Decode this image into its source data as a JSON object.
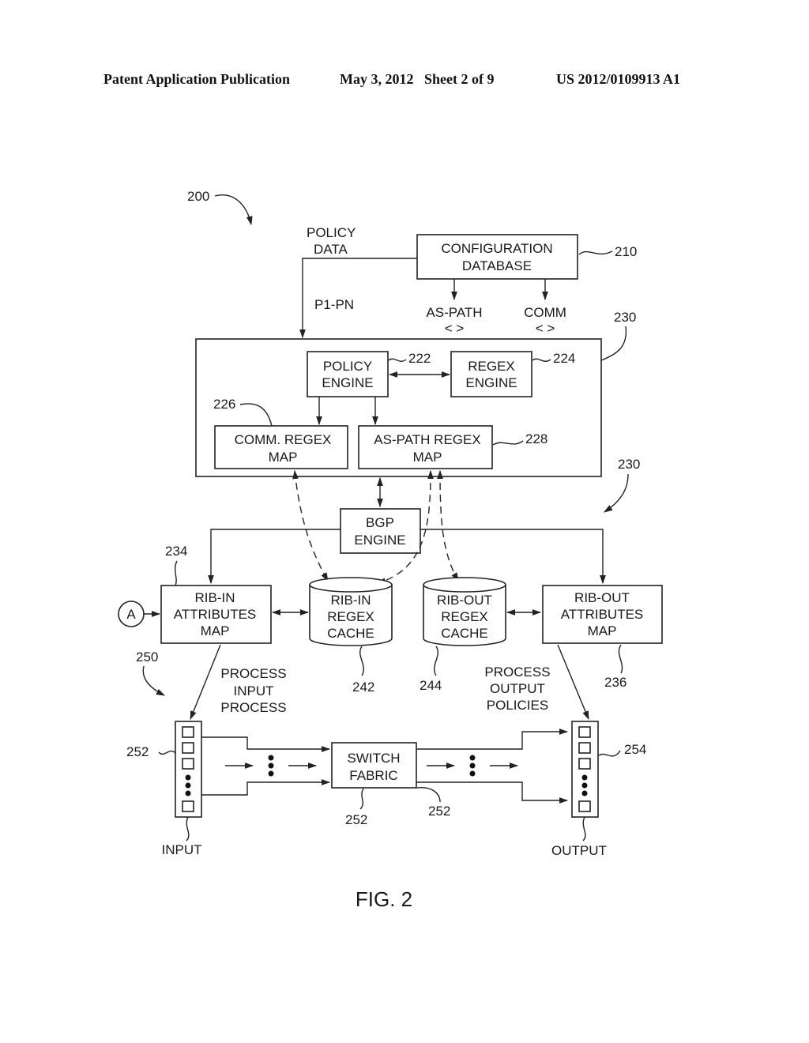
{
  "header": {
    "publication": "Patent Application Publication",
    "date_sheet": "May 3, 2012   Sheet 2 of 9",
    "number": "US 2012/0109913 A1"
  },
  "diagram": {
    "figure_label": "FIG. 2",
    "refs": {
      "system": "200",
      "config_db": "210",
      "policy_block": "230",
      "policy_engine": "222",
      "regex_engine": "224",
      "comm_map": "226",
      "aspath_map": "228",
      "bgp_block": "230",
      "rib_in_attr": "234",
      "rib_out_attr": "236",
      "rib_in_cache": "242",
      "rib_out_cache": "244",
      "forwarding": "250",
      "input_port": "252",
      "fabric": "252",
      "fabric_out": "252",
      "output_port": "254"
    },
    "labels": {
      "policy_data": [
        "POLICY",
        "DATA"
      ],
      "p1_pn": "P1-PN",
      "config_db": [
        "CONFIGURATION",
        "DATABASE"
      ],
      "as_path": [
        "AS-PATH",
        "< >"
      ],
      "comm": [
        "COMM",
        "< >"
      ],
      "policy_engine": [
        "POLICY",
        "ENGINE"
      ],
      "regex_engine": [
        "REGEX",
        "ENGINE"
      ],
      "comm_map": [
        "COMM. REGEX",
        "MAP"
      ],
      "aspath_map": [
        "AS-PATH REGEX",
        "MAP"
      ],
      "bgp_engine": [
        "BGP",
        "ENGINE"
      ],
      "rib_in_attr": [
        "RIB-IN",
        "ATTRIBUTES",
        "MAP"
      ],
      "rib_in_cache": [
        "RIB-IN",
        "REGEX",
        "CACHE"
      ],
      "rib_out_cache": [
        "RIB-OUT",
        "REGEX",
        "CACHE"
      ],
      "rib_out_attr": [
        "RIB-OUT",
        "ATTRIBUTES",
        "MAP"
      ],
      "connector_a": "A",
      "process_input": [
        "PROCESS",
        "INPUT",
        "PROCESS"
      ],
      "process_output": [
        "PROCESS",
        "OUTPUT",
        "POLICIES"
      ],
      "switch_fabric": [
        "SWITCH",
        "FABRIC"
      ],
      "input": "INPUT",
      "output": "OUTPUT"
    }
  }
}
